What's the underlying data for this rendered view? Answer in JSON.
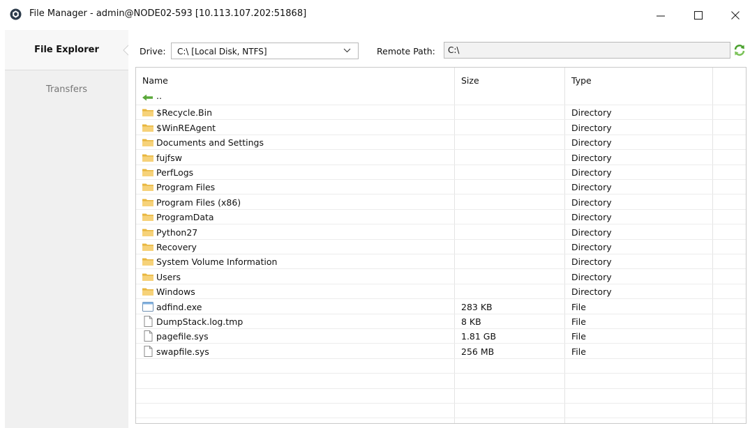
{
  "window": {
    "title": "File Manager - admin@NODE02-593 [10.113.107.202:51868]",
    "controls": {
      "minimize": "minimize-icon",
      "maximize": "maximize-icon",
      "close": "close-icon"
    }
  },
  "sidebar": {
    "items": [
      {
        "label": "File Explorer",
        "active": true
      },
      {
        "label": "Transfers",
        "active": false
      }
    ]
  },
  "toolbar": {
    "drive_label": "Drive:",
    "drive_value": "C:\\ [Local Disk, NTFS]",
    "remote_path_label": "Remote Path:",
    "remote_path_value": "C:\\",
    "refresh_icon": "refresh-icon"
  },
  "table": {
    "columns": [
      "Name",
      "Size",
      "Type"
    ],
    "rows": [
      {
        "icon": "up-arrow-icon",
        "name": "..",
        "size": "",
        "type": ""
      },
      {
        "icon": "folder-icon",
        "name": "$Recycle.Bin",
        "size": "",
        "type": "Directory"
      },
      {
        "icon": "folder-icon",
        "name": "$WinREAgent",
        "size": "",
        "type": "Directory"
      },
      {
        "icon": "folder-icon",
        "name": "Documents and Settings",
        "size": "",
        "type": "Directory"
      },
      {
        "icon": "folder-icon",
        "name": "fujfsw",
        "size": "",
        "type": "Directory"
      },
      {
        "icon": "folder-icon",
        "name": "PerfLogs",
        "size": "",
        "type": "Directory"
      },
      {
        "icon": "folder-icon",
        "name": "Program Files",
        "size": "",
        "type": "Directory"
      },
      {
        "icon": "folder-icon",
        "name": "Program Files (x86)",
        "size": "",
        "type": "Directory"
      },
      {
        "icon": "folder-icon",
        "name": "ProgramData",
        "size": "",
        "type": "Directory"
      },
      {
        "icon": "folder-icon",
        "name": "Python27",
        "size": "",
        "type": "Directory"
      },
      {
        "icon": "folder-icon",
        "name": "Recovery",
        "size": "",
        "type": "Directory"
      },
      {
        "icon": "folder-icon",
        "name": "System Volume Information",
        "size": "",
        "type": "Directory"
      },
      {
        "icon": "folder-icon",
        "name": "Users",
        "size": "",
        "type": "Directory"
      },
      {
        "icon": "folder-icon",
        "name": "Windows",
        "size": "",
        "type": "Directory"
      },
      {
        "icon": "exe-file-icon",
        "name": "adfind.exe",
        "size": "283 KB",
        "type": "File"
      },
      {
        "icon": "file-icon",
        "name": "DumpStack.log.tmp",
        "size": "8 KB",
        "type": "File"
      },
      {
        "icon": "file-icon",
        "name": "pagefile.sys",
        "size": "1.81 GB",
        "type": "File"
      },
      {
        "icon": "file-icon",
        "name": "swapfile.sys",
        "size": "256 MB",
        "type": "File"
      }
    ]
  },
  "colors": {
    "folder": "#f2c65a",
    "up_arrow": "#5aa83a",
    "sidebar_bg": "#f0f0f0",
    "grid_line": "#e3e3e3"
  }
}
